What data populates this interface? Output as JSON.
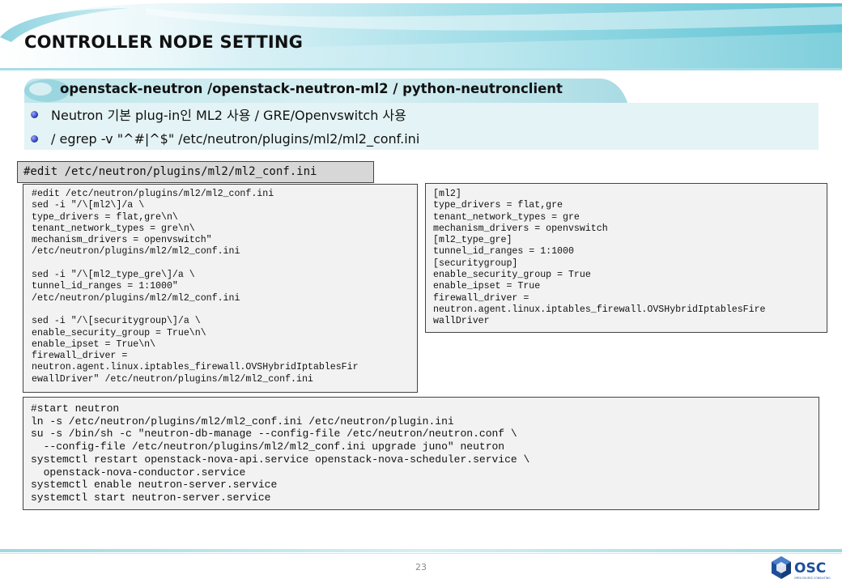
{
  "slide": {
    "title": "CONTROLLER NODE SETTING",
    "subtitle": "openstack-neutron /openstack-neutron-ml2 / python-neutronclient",
    "bullets": [
      {
        "text": "Neutron 기본 plug-in인 ML2 사용 / GRE/Openvswitch 사용"
      },
      {
        "text": " / egrep -v \"^#|^$\" /etc/neutron/plugins/ml2/ml2_conf.ini"
      }
    ],
    "edit_label": "#edit /etc/neutron/plugins/ml2/ml2_conf.ini",
    "code_left": "#edit /etc/neutron/plugins/ml2/ml2_conf.ini\nsed -i \"/\\[ml2\\]/a \\\ntype_drivers = flat,gre\\n\\\ntenant_network_types = gre\\n\\\nmechanism_drivers = openvswitch\"\n/etc/neutron/plugins/ml2/ml2_conf.ini\n\nsed -i \"/\\[ml2_type_gre\\]/a \\\ntunnel_id_ranges = 1:1000\"\n/etc/neutron/plugins/ml2/ml2_conf.ini\n\nsed -i \"/\\[securitygroup\\]/a \\\nenable_security_group = True\\n\\\nenable_ipset = True\\n\\\nfirewall_driver =\nneutron.agent.linux.iptables_firewall.OVSHybridIptablesFir\newallDriver\" /etc/neutron/plugins/ml2/ml2_conf.ini",
    "code_right": "[ml2]\ntype_drivers = flat,gre\ntenant_network_types = gre\nmechanism_drivers = openvswitch\n[ml2_type_gre]\ntunnel_id_ranges = 1:1000\n[securitygroup]\nenable_security_group = True\nenable_ipset = True\nfirewall_driver =\nneutron.agent.linux.iptables_firewall.OVSHybridIptablesFire\nwallDriver",
    "code_bottom": "#start neutron\nln -s /etc/neutron/plugins/ml2/ml2_conf.ini /etc/neutron/plugin.ini\nsu -s /bin/sh -c \"neutron-db-manage --config-file /etc/neutron/neutron.conf \\\n  --config-file /etc/neutron/plugins/ml2/ml2_conf.ini upgrade juno\" neutron\nsystemctl restart openstack-nova-api.service openstack-nova-scheduler.service \\\n  openstack-nova-conductor.service\nsystemctl enable neutron-server.service\nsystemctl start neutron-server.service",
    "page_number": "23"
  },
  "logo": {
    "text": "OSC",
    "tagline": "OPEN SOURCE CONSULTING"
  },
  "colors": {
    "header_teal": "#5ec3d3",
    "bullet_box_bg": "#e4f3f5",
    "code_bg": "#f2f2f2",
    "label_bg": "#d7d7d7",
    "logo_blue": "#1f4f9a"
  },
  "icons": {
    "header": "teal-wave-banner",
    "subtitle": "teal-rounded-tab",
    "bullet": "blue-dot-bullet",
    "logo": "osc-hexagon-logo"
  }
}
